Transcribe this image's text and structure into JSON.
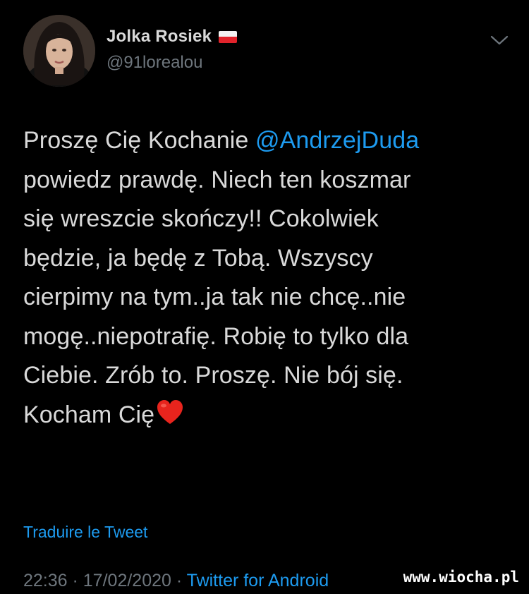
{
  "user": {
    "display_name": "Jolka Rosiek",
    "handle": "@91lorealou",
    "flag": "poland-flag-icon",
    "avatar": "avatar"
  },
  "tweet": {
    "text_before_mention": "Proszę Cię Kochanie ",
    "mention": "@AndrzejDuda",
    "text_after_mention": "\npowiedz prawdę. Niech ten koszmar\nsię wreszcie skończy!! Cokolwiek\nbędzie, ja będę z Tobą. Wszyscy\ncierpimy na tym..ja tak nie chcę..nie\nmogę..niepotrafię. Robię to tylko dla\nCiebie. Zrób to. Proszę. Nie bój się.\nKocham Cię",
    "emoji": "red-heart-icon"
  },
  "translate_label": "Traduire le Tweet",
  "meta": {
    "time": "22:36",
    "separator1": " · ",
    "date": "17/02/2020",
    "separator2": " · ",
    "source": "Twitter for Android"
  },
  "watermark": "www.wiocha.pl",
  "colors": {
    "background": "#000000",
    "text": "#d9d9d9",
    "secondary": "#6e767d",
    "accent": "#1d9bf0",
    "heart": "#e8241d"
  }
}
